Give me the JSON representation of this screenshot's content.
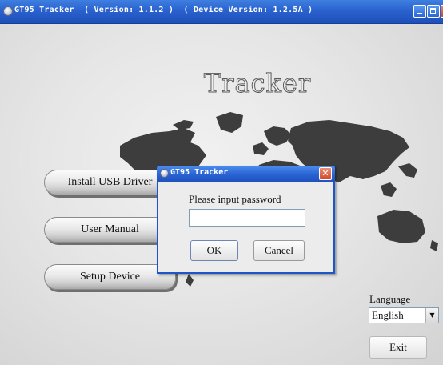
{
  "window": {
    "title": "GT95 Tracker  ( Version: 1.1.2 )  ( Device Version: 1.2.5A )",
    "icon": "tracker-app-icon"
  },
  "main": {
    "heading": "Tracker",
    "buttons": {
      "install_usb_driver": "Install USB Driver",
      "user_manual": "User Manual",
      "setup_device": "Setup Device"
    },
    "language": {
      "label": "Language",
      "selected": "English"
    },
    "exit_label": "Exit"
  },
  "dialog": {
    "title": "GT95 Tracker",
    "prompt": "Please input password",
    "password_value": "",
    "ok_label": "OK",
    "cancel_label": "Cancel",
    "close_glyph": "✕"
  },
  "colors": {
    "titlebar": "#2a62cf",
    "dialog_border": "#1c56c8",
    "close_button": "#cc4a2f",
    "background": "#e6e6e6"
  }
}
